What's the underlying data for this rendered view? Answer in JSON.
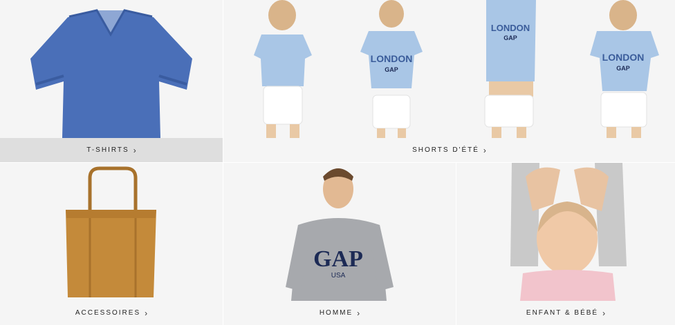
{
  "categories": {
    "tshirts": {
      "label": "T-SHIRTS",
      "chevron": "›"
    },
    "shorts": {
      "label": "SHORTS D'ÉTÉ",
      "chevron": "›"
    },
    "accessoires": {
      "label": "ACCESSOIRES",
      "chevron": "›"
    },
    "homme": {
      "label": "HOMME",
      "chevron": "›"
    },
    "enfant": {
      "label": "ENFANT & BÉBÉ",
      "chevron": "›"
    }
  },
  "print_text": {
    "london": "LONDON",
    "gap": "GAP",
    "sweat_gap": "GAP",
    "sweat_usa": "USA"
  },
  "colors": {
    "tile_bg": "#f5f5f5",
    "active_label_bg": "#dedede",
    "tee_blue": "#4a6fb8",
    "light_blue": "#a9c6e6",
    "tote_tan": "#c48a3a",
    "sweat_grey": "#a7a9ad",
    "gap_navy": "#1c2a55"
  },
  "images": {
    "tshirts": "blue-v-neck-tshirt",
    "shorts": "model-light-blue-tee-white-shorts-x4",
    "accessoires": "tan-leather-tote-bag",
    "homme": "man-grey-gap-sweatshirt",
    "enfant": "girl-pink-tee-arms-up"
  }
}
